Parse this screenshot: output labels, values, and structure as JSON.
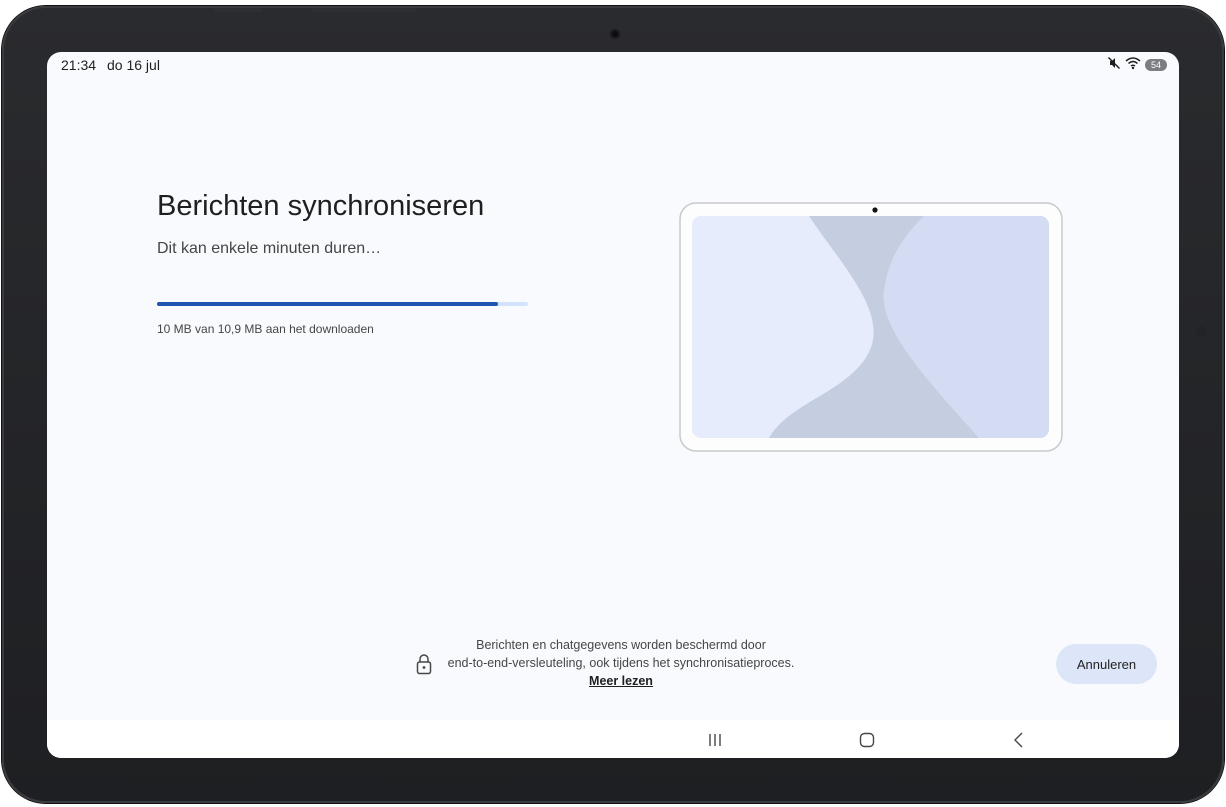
{
  "status_bar": {
    "time": "21:34",
    "date": "do 16 jul",
    "icons": [
      "mute-icon",
      "wifi-icon",
      "battery-icon"
    ],
    "battery_level": "54"
  },
  "sync": {
    "title": "Berichten synchroniseren",
    "subtitle": "Dit kan enkele minuten duren…",
    "progress_fraction": 0.92,
    "progress_text": "10 MB van 10,9 MB aan het downloaden"
  },
  "notice": {
    "line1": "Berichten en chatgegevens worden beschermd door",
    "line2": "end-to-end-versleuteling, ook tijdens het synchronisatieproces.",
    "link_label": "Meer lezen"
  },
  "actions": {
    "cancel_label": "Annuleren"
  },
  "navigation": {
    "buttons": [
      "recent-apps-icon",
      "home-icon",
      "back-icon"
    ]
  },
  "colors": {
    "background": "#f8fafd",
    "accent": "#1f55b2",
    "progress_track": "#d3e3fd",
    "button_bg": "#dce6f8"
  }
}
